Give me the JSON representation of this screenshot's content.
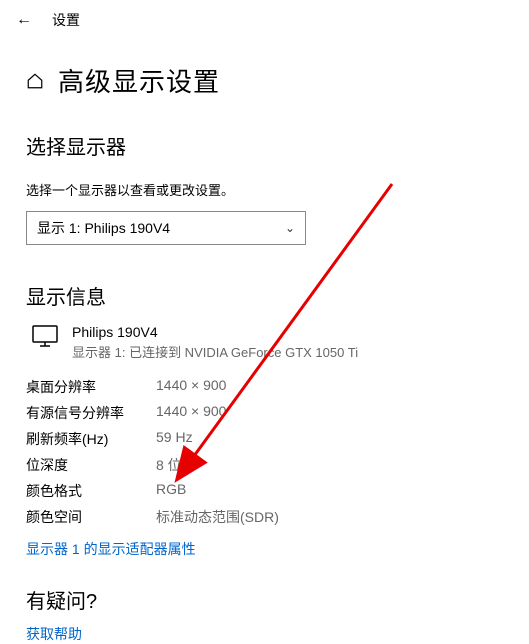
{
  "header": {
    "title": "设置"
  },
  "page": {
    "title": "高级显示设置"
  },
  "select_display": {
    "heading": "选择显示器",
    "instruction": "选择一个显示器以查看或更改设置。",
    "selected": "显示 1: Philips 190V4"
  },
  "display_info": {
    "heading": "显示信息",
    "monitor_name": "Philips 190V4",
    "monitor_sub": "显示器 1: 已连接到 NVIDIA GeForce GTX 1050 Ti",
    "props": {
      "desktop_res_label": "桌面分辨率",
      "desktop_res_value": "1440 × 900",
      "active_res_label": "有源信号分辨率",
      "active_res_value": "1440 × 900",
      "refresh_label": "刷新频率(Hz)",
      "refresh_value": "59 Hz",
      "bit_depth_label": "位深度",
      "bit_depth_value": "8 位",
      "color_format_label": "颜色格式",
      "color_format_value": "RGB",
      "color_space_label": "颜色空间",
      "color_space_value": "标准动态范围(SDR)"
    },
    "adapter_link": "显示器 1 的显示适配器属性"
  },
  "help": {
    "heading": "有疑问?",
    "link": "获取帮助"
  }
}
